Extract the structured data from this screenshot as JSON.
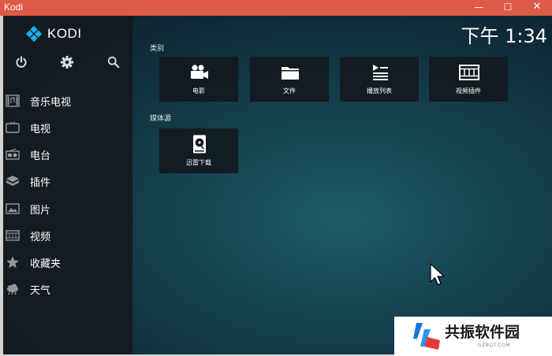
{
  "window": {
    "title": "Kodi",
    "minimize": "—",
    "maximize": "☐",
    "close": "✕"
  },
  "brand": {
    "name": "KODI"
  },
  "clock": "下午 1:34",
  "menu": [
    {
      "label": "音乐电视",
      "icon": "music-video-icon"
    },
    {
      "label": "电视",
      "icon": "tv-icon"
    },
    {
      "label": "电台",
      "icon": "radio-icon"
    },
    {
      "label": "插件",
      "icon": "addons-icon"
    },
    {
      "label": "图片",
      "icon": "pictures-icon"
    },
    {
      "label": "视频",
      "icon": "video-icon"
    },
    {
      "label": "收藏夹",
      "icon": "favourites-icon"
    },
    {
      "label": "天气",
      "icon": "weather-icon"
    }
  ],
  "sections": {
    "categories_title": "类别",
    "categories": [
      {
        "label": "电影",
        "icon": "movie-camera-icon"
      },
      {
        "label": "文件",
        "icon": "folder-icon"
      },
      {
        "label": "播放列表",
        "icon": "playlist-icon"
      },
      {
        "label": "视频插件",
        "icon": "film-strip-icon"
      }
    ],
    "sources_title": "媒体源",
    "sources": [
      {
        "label": "迅雷下载",
        "icon": "drive-icon"
      }
    ]
  },
  "watermark": {
    "title": "共振软件园",
    "subtitle": "GZBQT.COM"
  },
  "colors": {
    "titlebar": "#de5a48",
    "background": "#154351",
    "sidebar": "#141a20"
  }
}
